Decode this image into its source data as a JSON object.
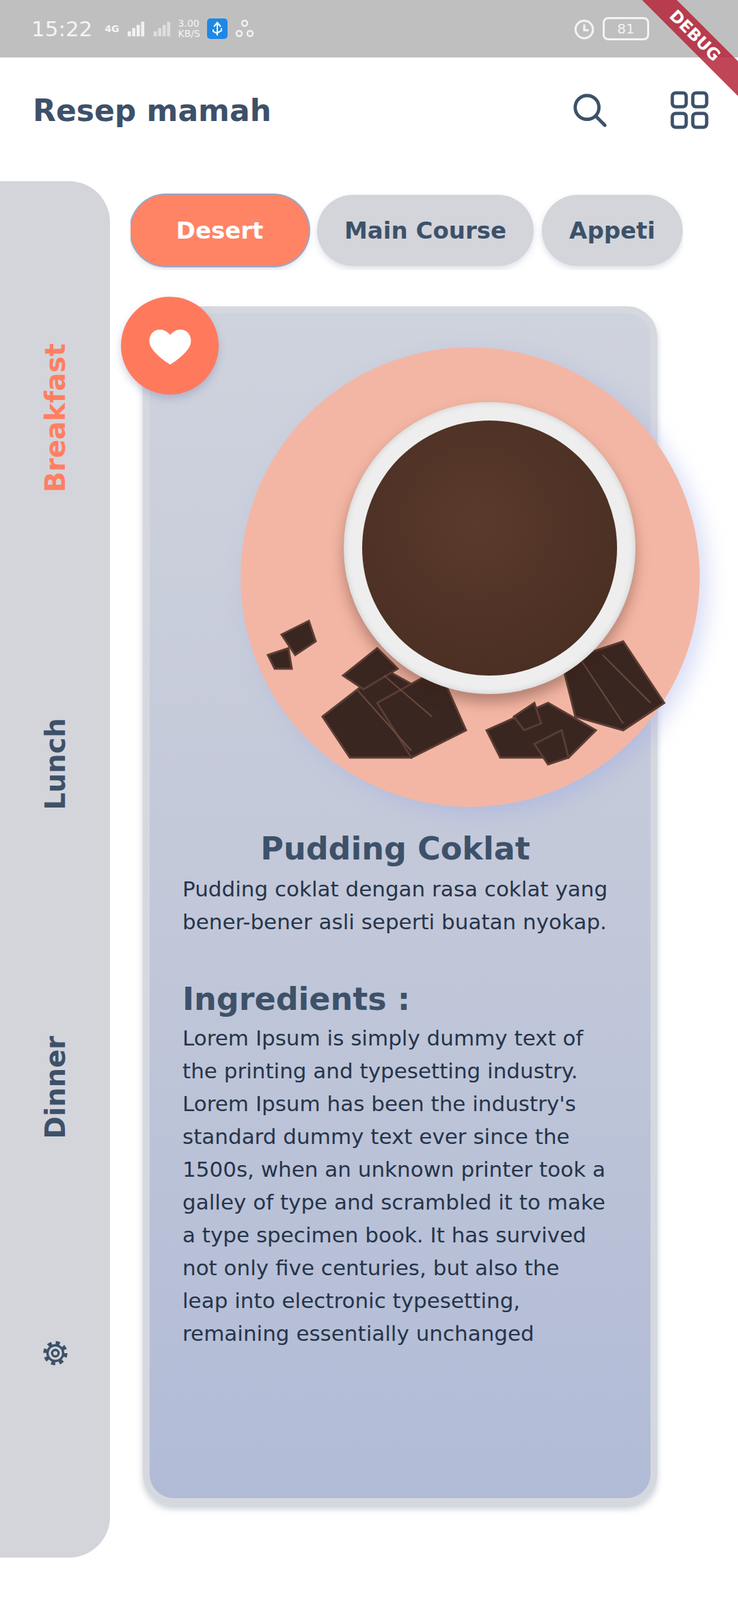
{
  "status_bar": {
    "time": "15:22",
    "network": "4G",
    "speed": "3.00",
    "speed_unit": "KB/S",
    "battery": "81"
  },
  "debug_banner": "DEBUG",
  "app_bar": {
    "title": "Resep mamah"
  },
  "sidebar": {
    "items": [
      {
        "label": "Breakfast",
        "selected": true
      },
      {
        "label": "Lunch",
        "selected": false
      },
      {
        "label": "Dinner",
        "selected": false
      }
    ]
  },
  "categories": [
    {
      "label": "Desert",
      "selected": true
    },
    {
      "label": "Main Course",
      "selected": false
    },
    {
      "label": "Appeti",
      "selected": false
    }
  ],
  "recipe": {
    "title": "Pudding Coklat",
    "favorite": true,
    "description": "Pudding coklat dengan rasa coklat yang bener-bener asli seperti buatan nyokap.",
    "ingredients_label": "Ingredients :",
    "ingredients": "Lorem Ipsum is simply dummy text of the printing and typesetting industry. Lorem Ipsum has been the industry's standard dummy text ever since the 1500s, when an unknown printer took a galley of type and scrambled it to make a type specimen book. It has survived not only five centuries, but also the leap into electronic typesetting, remaining essentially unchanged"
  }
}
